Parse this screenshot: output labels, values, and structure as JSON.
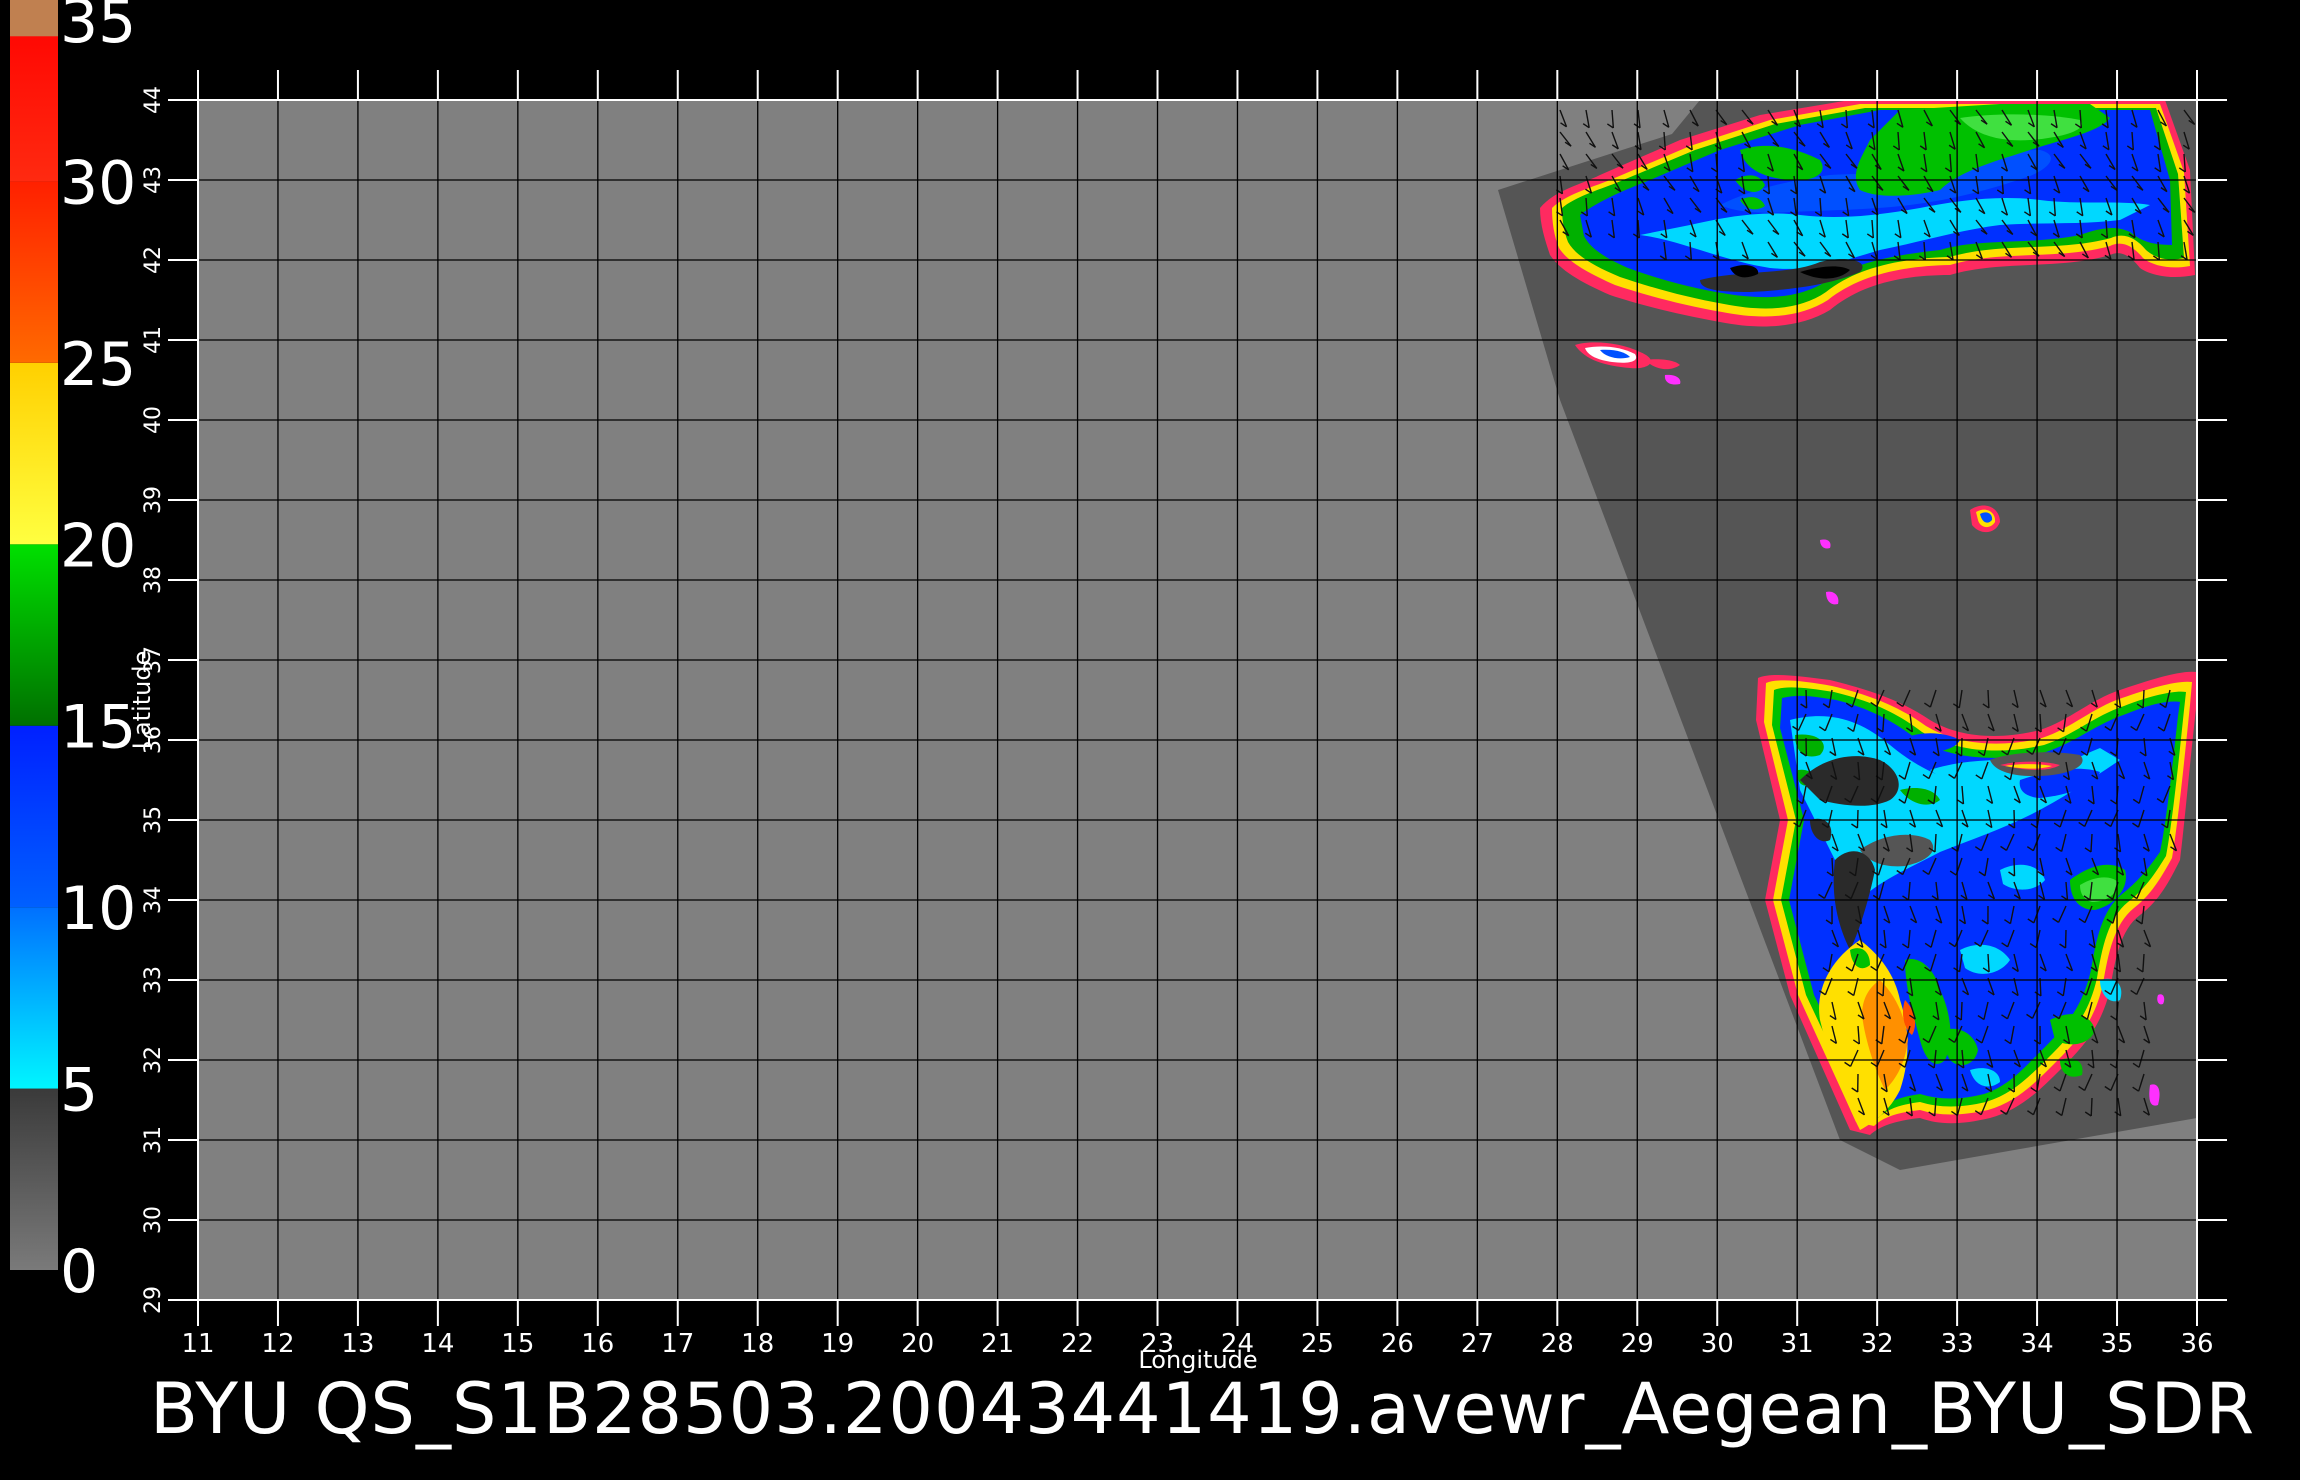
{
  "title": "BYU  QS_S1B28503.20043441419.avewr_Aegean_BYU_SDR",
  "axes": {
    "xlabel": "Longitude",
    "ylabel": "Latitude",
    "lon_range": [
      11,
      36
    ],
    "lat_range": [
      29,
      44
    ],
    "lon_ticks": [
      "11",
      "12",
      "13",
      "14",
      "15",
      "16",
      "17",
      "18",
      "19",
      "20",
      "21",
      "22",
      "23",
      "24",
      "25",
      "26",
      "27",
      "28",
      "29",
      "30",
      "31",
      "32",
      "33",
      "34",
      "35",
      "36"
    ],
    "lat_ticks": [
      "29",
      "30",
      "31",
      "32",
      "33",
      "34",
      "35",
      "36",
      "37",
      "38",
      "39",
      "40",
      "41",
      "42",
      "43",
      "44"
    ],
    "grid": true
  },
  "colorbar": {
    "labels": [
      "0",
      "5",
      "10",
      "15",
      "20",
      "25",
      "30",
      "35"
    ],
    "range": [
      0,
      35
    ],
    "stops": [
      {
        "from": 0,
        "to": 5,
        "top": "#3a3a3a",
        "bottom": "#7a7a7a"
      },
      {
        "from": 5,
        "to": 10,
        "top": "#0070ff",
        "bottom": "#00f6ff"
      },
      {
        "from": 10,
        "to": 15,
        "top": "#0020ff",
        "bottom": "#0060ff"
      },
      {
        "from": 15,
        "to": 20,
        "top": "#00e000",
        "bottom": "#007000"
      },
      {
        "from": 20,
        "to": 25,
        "top": "#ffd000",
        "bottom": "#ffff40"
      },
      {
        "from": 25,
        "to": 30,
        "top": "#ff2000",
        "bottom": "#ff6a00"
      },
      {
        "from": 30,
        "to": 35,
        "top": "#ff0000",
        "bottom": "#ff2a10"
      },
      {
        "from": 34,
        "to": 35,
        "top": "#c08050",
        "bottom": "#c08050"
      }
    ]
  },
  "colors": {
    "background": "#000000",
    "map_background": "#808080",
    "swath": "#555555",
    "grid": "#000000",
    "text": "#ffffff"
  }
}
